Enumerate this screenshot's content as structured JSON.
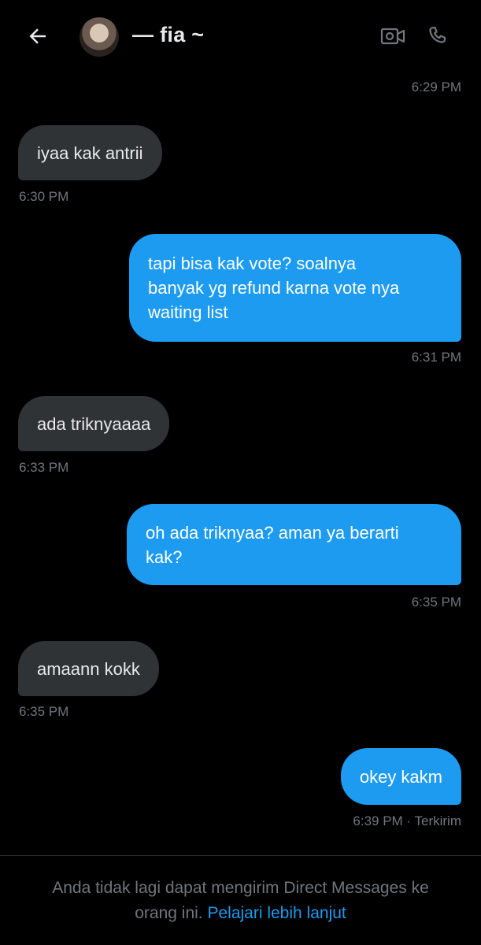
{
  "header": {
    "contact_name": "— fia ~"
  },
  "messages": [
    {
      "id": "m0",
      "direction": "out",
      "text": "",
      "time": "6:29 PM"
    },
    {
      "id": "m1",
      "direction": "in",
      "text": "iyaa kak antrii",
      "time": "6:30 PM"
    },
    {
      "id": "m2",
      "direction": "out",
      "text": "tapi bisa kak vote? soalnya banyak yg refund karna vote nya waiting list",
      "lines": [
        "tapi bisa kak vote? soalnya",
        "banyak yg refund karna vote nya",
        "waiting list"
      ],
      "time": "6:31 PM"
    },
    {
      "id": "m3",
      "direction": "in",
      "text": "ada triknyaaaa",
      "time": "6:33 PM"
    },
    {
      "id": "m4",
      "direction": "out",
      "text": "oh ada triknyaa? aman ya berarti kak?",
      "lines": [
        "oh ada triknyaa? aman ya berarti",
        "kak?"
      ],
      "time": "6:35 PM"
    },
    {
      "id": "m5",
      "direction": "in",
      "text": "amaann kokk",
      "time": "6:35 PM"
    },
    {
      "id": "m6",
      "direction": "out",
      "text": "okey kakm",
      "time": "6:39 PM · Terkirim"
    }
  ],
  "footer": {
    "notice": "Anda tidak lagi dapat mengirim Direct Messages ke orang ini.",
    "notice_line1": "Anda tidak lagi dapat mengirim Direct Messages ke",
    "notice_line2": "orang ini.",
    "link_label": "Pelajari lebih lanjut"
  },
  "icons": {
    "back": "arrow-left-icon",
    "video": "video-camera-icon",
    "call": "phone-icon"
  },
  "colors": {
    "background": "#000000",
    "outgoing_bubble": "#1d9bf0",
    "incoming_bubble": "#2f3336",
    "timestamp": "#71767b",
    "link": "#1d9bf0",
    "text": "#e7e9ea"
  }
}
